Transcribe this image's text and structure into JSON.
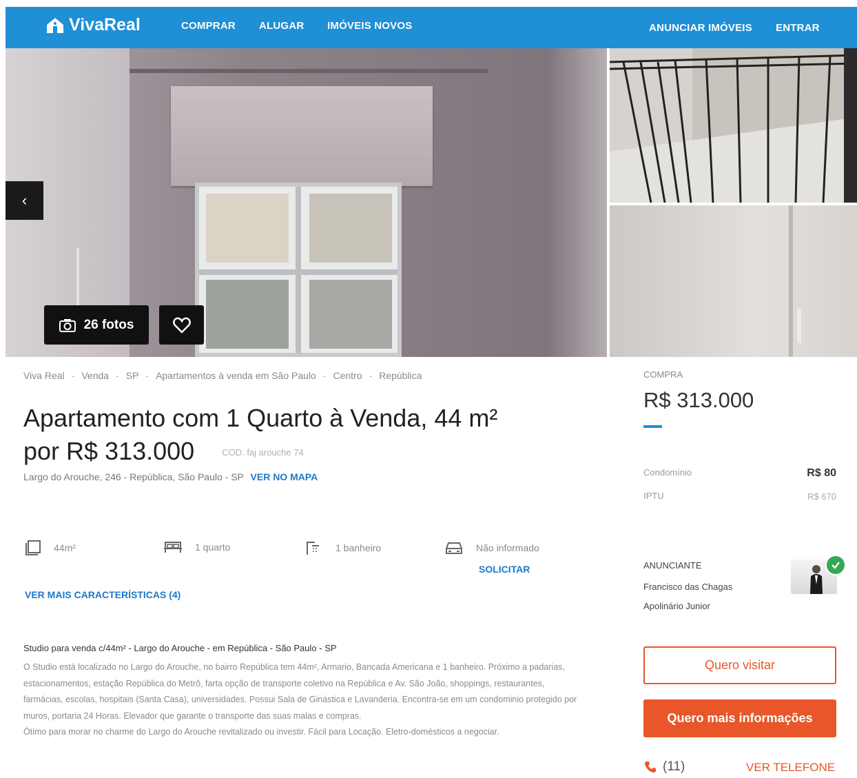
{
  "nav": {
    "logo": "VivaReal",
    "comprar": "COMPRAR",
    "alugar": "ALUGAR",
    "imoveis_novos": "IMÓVEIS NOVOS",
    "anunciar": "ANUNCIAR IMÓVEIS",
    "entrar": "ENTRAR"
  },
  "gallery": {
    "photos_label": "26 fotos",
    "prev_arrow": "‹"
  },
  "breadcrumb": [
    "Viva Real",
    "Venda",
    "SP",
    "Apartamentos à venda em São Paulo",
    "Centro",
    "República"
  ],
  "listing": {
    "title_line1": "Apartamento com 1 Quarto à Venda, 44 m²",
    "title_line2": "por R$ 313.000",
    "code": "COD. faj arouche 74",
    "address": "Largo do Arouche, 246 - República, São Paulo - SP",
    "map_link": "VER NO MAPA"
  },
  "features": {
    "area": "44m²",
    "quartos": "1 quarto",
    "banheiros": "1 banheiro",
    "vagas": "Não informado",
    "solicitar": "SOLICITAR",
    "ver_mais": "VER MAIS CARACTERÍSTICAS (4)"
  },
  "description": {
    "title": "Studio para venda c/44m² - Largo do Arouche - em República - São Paulo - SP",
    "body1": "O Studio está localizado no Largo do Arouche, no bairro República tem 44m², Armario, Bancada Americana e 1 banheiro. Próximo a padarias, estacionamentos, estação República do Metrô, farta opção de transporte coletivo na República e Av. São João, shoppings, restaurantes, farmácias, escolas, hospitais (Santa Casa), universidades. Possui Sala de Ginástica e Lavanderia. Encontra-se em um condominio protegido por muros, portaria 24 Horas. Elevador que garante o transporte das suas malas e compras.",
    "body2": "Ótimo para morar no charme do Largo do Arouche revitalizado ou investir. Fácil para Locação. Eletro-domésticos a negociar."
  },
  "pricing": {
    "label": "COMPRA",
    "price": "R$ 313.000",
    "condominio_label": "Condomínio",
    "condominio_value": "R$ 80",
    "iptu_label": "IPTU",
    "iptu_value": "R$ 670"
  },
  "advertiser": {
    "label": "ANUNCIANTE",
    "name": "Francisco das Chagas Apolinário Junior"
  },
  "actions": {
    "visit": "Quero visitar",
    "info": "Quero mais informações",
    "phone": "(11)",
    "ver_telefone": "VER TELEFONE"
  },
  "colors": {
    "brand_blue": "#1f8fd6",
    "accent_orange": "#e8562a",
    "verified_green": "#34a853"
  }
}
